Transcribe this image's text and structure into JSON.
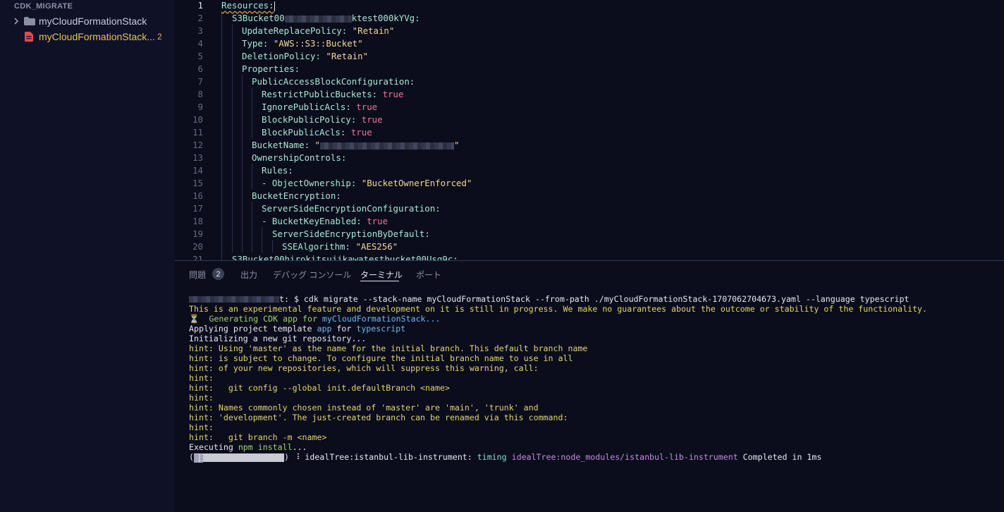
{
  "sidebar": {
    "section_title": "CDK_MIGRATE",
    "items": [
      {
        "label": "myCloudFormationStack",
        "icon": "folder-icon"
      },
      {
        "label": "myCloudFormationStack...",
        "icon": "yaml-file-icon",
        "badge": "2"
      }
    ]
  },
  "editor": {
    "line_numbers": [
      "1",
      "2",
      "3",
      "4",
      "5",
      "6",
      "7",
      "8",
      "9",
      "10",
      "11",
      "12",
      "13",
      "14",
      "15",
      "16",
      "17",
      "18",
      "19",
      "20",
      "21"
    ],
    "lines": {
      "l1_key": "Resources:",
      "l2_prefix": "S3Bucket00",
      "l2_suffix": "ktest000kYVg:",
      "l3_key": "UpdateReplacePolicy:",
      "l3_val": "\"Retain\"",
      "l4_key": "Type:",
      "l4_val": "\"AWS::S3::Bucket\"",
      "l5_key": "DeletionPolicy:",
      "l5_val": "\"Retain\"",
      "l6_key": "Properties:",
      "l7_key": "PublicAccessBlockConfiguration:",
      "l8_key": "RestrictPublicBuckets:",
      "l8_val": "true",
      "l9_key": "IgnorePublicAcls:",
      "l9_val": "true",
      "l10_key": "BlockPublicPolicy:",
      "l10_val": "true",
      "l11_key": "BlockPublicAcls:",
      "l11_val": "true",
      "l12_key": "BucketName:",
      "l12_open": "\"",
      "l12_close": "\"",
      "l13_key": "OwnershipControls:",
      "l14_key": "Rules:",
      "l15_dash": "- ",
      "l15_key": "ObjectOwnership:",
      "l15_val": "\"BucketOwnerEnforced\"",
      "l16_key": "BucketEncryption:",
      "l17_key": "ServerSideEncryptionConfiguration:",
      "l18_dash": "- ",
      "l18_key": "BucketKeyEnabled:",
      "l18_val": "true",
      "l19_key": "ServerSideEncryptionByDefault:",
      "l20_key": "SSEAlgorithm:",
      "l20_val": "\"AES256\"",
      "l21_key": "S3Bucket00hirokitsujikawatestbucket00Usg9c:"
    }
  },
  "panel": {
    "tabs": [
      {
        "label": "問題",
        "badge": "2"
      },
      {
        "label": "出力"
      },
      {
        "label": "デバッグ コンソール"
      },
      {
        "label": "ターミナル",
        "active": true
      },
      {
        "label": "ポート"
      }
    ]
  },
  "terminal": {
    "prompt_suffix": "t: $ ",
    "command": "cdk migrate --stack-name myCloudFormationStack --from-path ./myCloudFormationStack-1707062704673.yaml --language typescript",
    "warning": "This is an experimental feature and development on it is still in progress. We make no guarantees about the outcome or stability of the functionality.",
    "hourglass": "⏳",
    "generating_prefix": "  Generating CDK app for ",
    "generating_stack": "myCloudFormationStack...",
    "applying_prefix": "Applying project template ",
    "applying_app": "app",
    "applying_for": " for ",
    "applying_lang": "typescript",
    "init_repo": "Initializing a new git repository...",
    "hints": [
      "hint: Using 'master' as the name for the initial branch. This default branch name",
      "hint: is subject to change. To configure the initial branch name to use in all",
      "hint: of your new repositories, which will suppress this warning, call:",
      "hint:",
      "hint:   git config --global init.defaultBranch <name>",
      "hint:",
      "hint: Names commonly chosen instead of 'master' are 'main', 'trunk' and",
      "hint: 'development'. The just-created branch can be renamed via this command:",
      "hint:",
      "hint:   git branch -m <name>"
    ],
    "executing_prefix": "Executing ",
    "executing_cmd": "npm install",
    "executing_suffix": "...",
    "progress_open": "(",
    "progress_close": ")",
    "progress_fraction": 0.1,
    "spinner": "⠸",
    "tree_label": " idealTree:istanbul-lib-instrument: ",
    "timing": "timing",
    "tree_path": "idealTree:node_modules/istanbul-lib-instrument",
    "completed": " Completed in 1ms"
  }
}
